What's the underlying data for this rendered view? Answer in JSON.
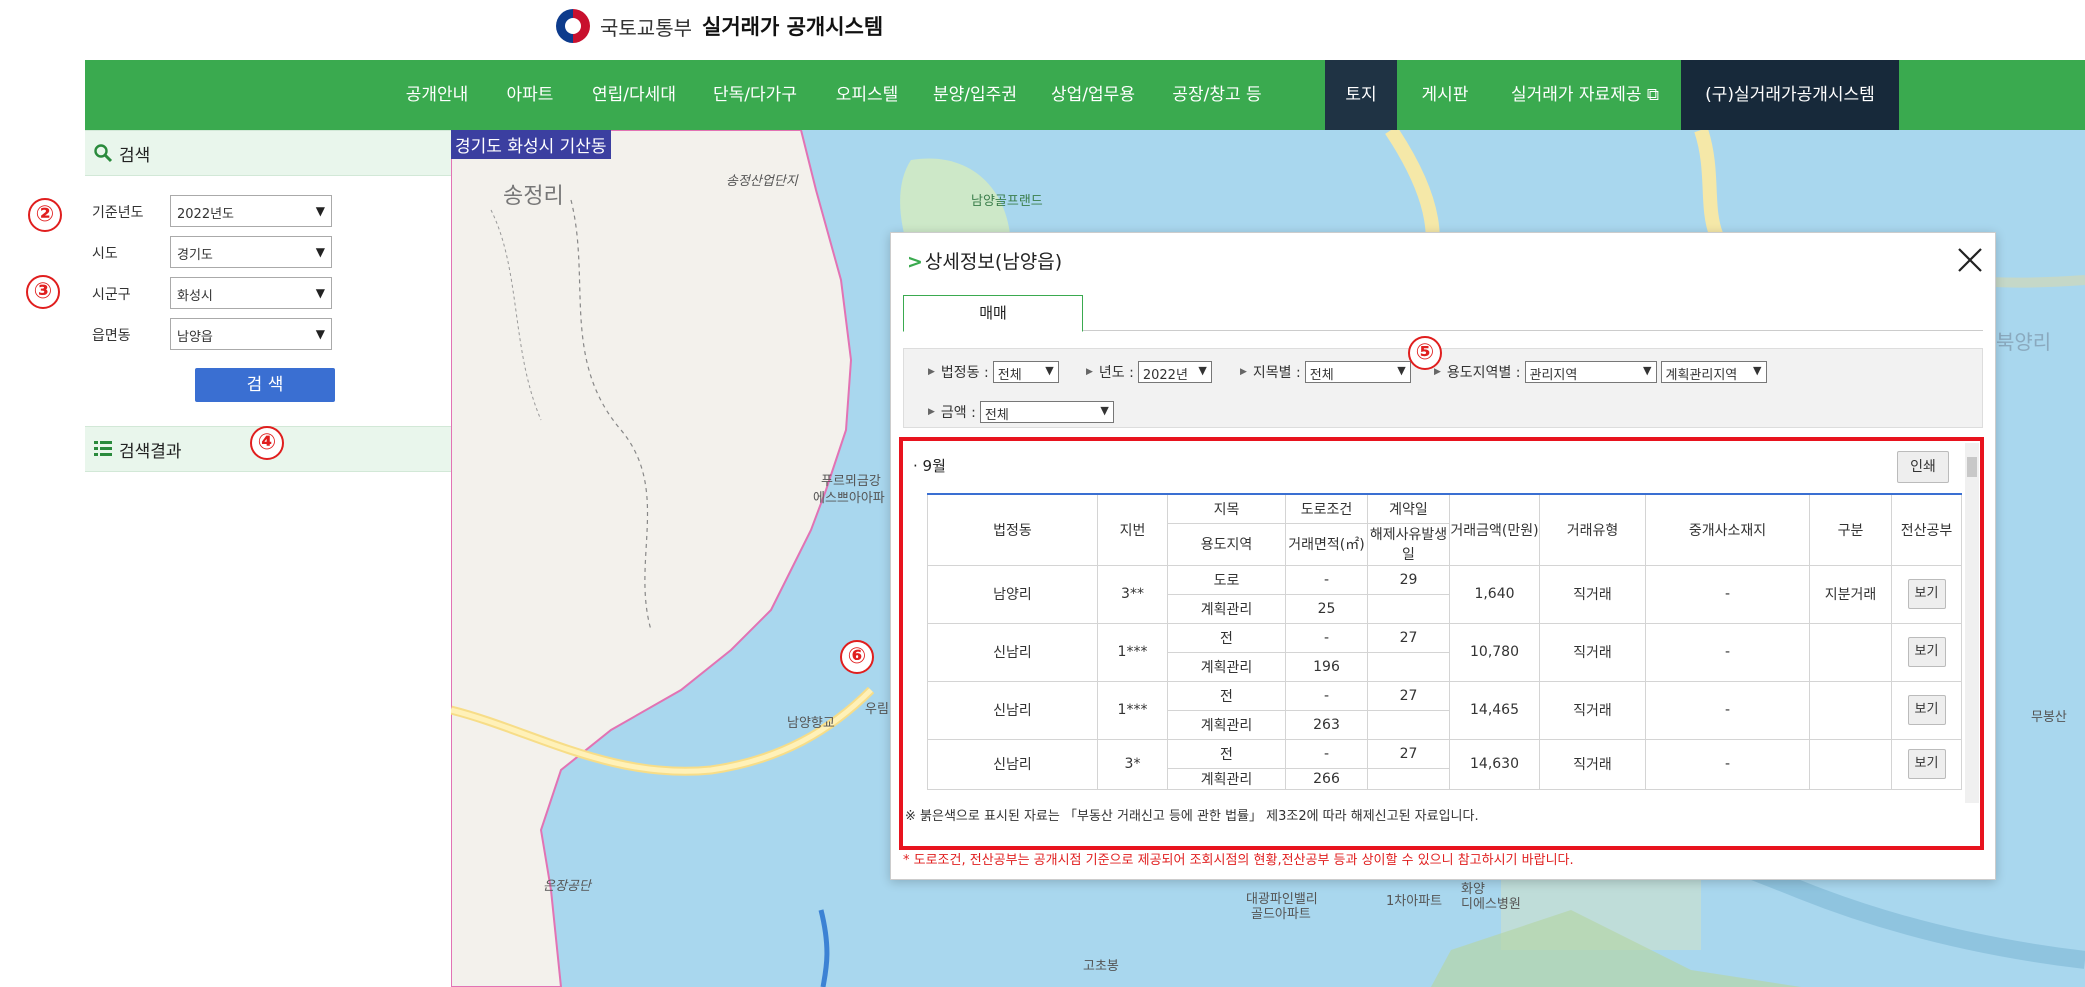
{
  "header": {
    "org_name": "국토교통부",
    "system_name": "실거래가 공개시스템"
  },
  "gnb": {
    "items": [
      {
        "label": "공개안내"
      },
      {
        "label": "아파트"
      },
      {
        "label": "연립/다세대"
      },
      {
        "label": "단독/다가구"
      },
      {
        "label": "오피스텔"
      },
      {
        "label": "분양/입주권"
      },
      {
        "label": "상업/업무용"
      },
      {
        "label": "공장/창고 등"
      },
      {
        "label": "토지"
      },
      {
        "label": "게시판"
      },
      {
        "label": "실거래가 자료제공 ⧉"
      },
      {
        "label": "(구)실거래가공개시스템"
      }
    ]
  },
  "sidebar": {
    "search_title": "검색",
    "fields": [
      {
        "label": "기준년도",
        "value": "2022년도"
      },
      {
        "label": "시도",
        "value": "경기도"
      },
      {
        "label": "시군구",
        "value": "화성시"
      },
      {
        "label": "읍면동",
        "value": "남양읍"
      }
    ],
    "search_button": "검 색",
    "result_title": "검색결과"
  },
  "markers": {
    "m2": "②",
    "m3": "③",
    "m4": "④",
    "m5": "⑤",
    "m6": "⑥"
  },
  "map": {
    "location_title": "경기도 화성시 기산동",
    "labels": {
      "songjeongri": "송정리",
      "industrial": "송정산업단지",
      "golf": "남양골프랜드",
      "apartment1": "푸르뫼금강",
      "apartment2": "에스쁘아아파",
      "namyang_school": "남양향교",
      "ureum": "우림",
      "ueunjang": "은장공단",
      "daegwang1": "대광파인밸리",
      "daegwang2": "골드아파트",
      "apt_1cha": "1차아파트",
      "hwayang1": "화양",
      "hwayang2": "디에스병원",
      "gochobong": "고초봉",
      "mubongsan": "무봉산",
      "bukyangri": "북양리"
    }
  },
  "modal": {
    "title": "상세정보(남양읍)",
    "tab_label": "매매",
    "filters": {
      "beopjeongdong_label": "법정동 :",
      "beopjeongdong_value": "전체",
      "year_label": "년도 :",
      "year_value": "2022년",
      "jimok_label": "지목별 :",
      "jimok_value": "전체",
      "zone_label": "용도지역별 :",
      "zone_value": "관리지역",
      "zone_sub_value": "계획관리지역",
      "price_label": "금액 :",
      "price_value": "전체"
    },
    "month_label": "· 9월",
    "print_button": "인쇄",
    "table": {
      "headers": {
        "dong": "법정동",
        "jibun": "지번",
        "jimok": "지목",
        "zone": "용도지역",
        "road": "도로조건",
        "area": "거래면적(㎡)",
        "contract": "계약일",
        "cancel": "해제사유발생일",
        "price": "거래금액(만원)",
        "type": "거래유형",
        "agent": "중개사소재지",
        "category": "구분",
        "registry": "전산공부"
      },
      "rows": [
        {
          "dong": "남양리",
          "jibun": "3**",
          "jimok": "도로",
          "zone": "계획관리",
          "road": "-",
          "area": "25",
          "contract": "29",
          "cancel": "",
          "price": "1,640",
          "type": "직거래",
          "agent": "-",
          "category": "지분거래",
          "button": "보기"
        },
        {
          "dong": "신남리",
          "jibun": "1***",
          "jimok": "전",
          "zone": "계획관리",
          "road": "-",
          "area": "196",
          "contract": "27",
          "cancel": "",
          "price": "10,780",
          "type": "직거래",
          "agent": "-",
          "category": "",
          "button": "보기"
        },
        {
          "dong": "신남리",
          "jibun": "1***",
          "jimok": "전",
          "zone": "계획관리",
          "road": "-",
          "area": "263",
          "contract": "27",
          "cancel": "",
          "price": "14,465",
          "type": "직거래",
          "agent": "-",
          "category": "",
          "button": "보기"
        },
        {
          "dong": "신남리",
          "jibun": "3*",
          "jimok": "전",
          "zone": "계획관리",
          "road": "-",
          "area": "266",
          "contract": "27",
          "cancel": "",
          "price": "14,630",
          "type": "직거래",
          "agent": "-",
          "category": "",
          "button": "보기"
        }
      ]
    },
    "note_black": "※ 붉은색으로 표시된 자료는 「부동산 거래신고 등에 관한 법률」 제3조2에 따라 해제신고된 자료입니다.",
    "note_red": "* 도로조건, 전산공부는 공개시점 기준으로 제공되어 조회시점의 현황,전산공부 등과 상이할 수 있으니 참고하시기 바랍니다."
  },
  "colors": {
    "nav_green": "#3aaa4f",
    "nav_active": "#1f3344",
    "search_button": "#3a6fd2",
    "annotation_red": "#e8131e",
    "map_water": "#a9d7ee"
  }
}
